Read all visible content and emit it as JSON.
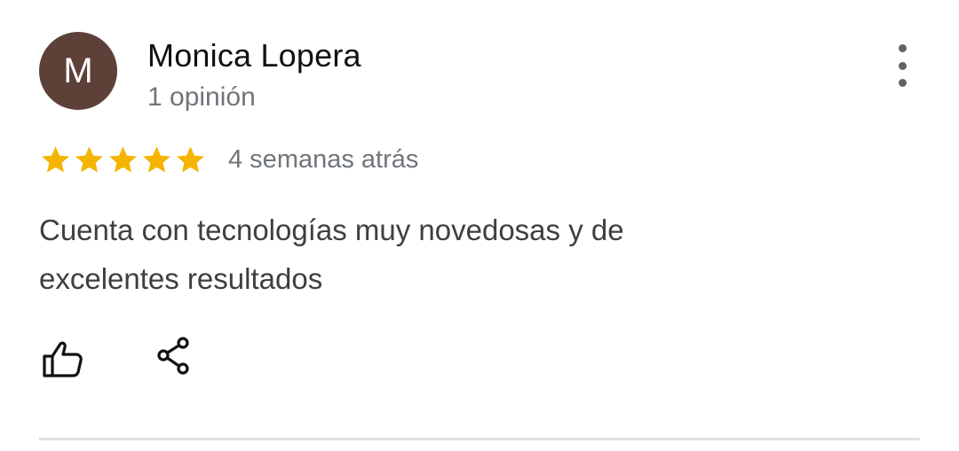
{
  "review": {
    "avatar_letter": "M",
    "avatar_color": "#5d4037",
    "author_name": "Monica Lopera",
    "review_count": "1 opinión",
    "rating": 5,
    "rating_max": 5,
    "star_color": "#f4b400",
    "time": "4 semanas atrás",
    "text": "Cuenta con tecnologías muy novedosas y de excelentes resultados"
  },
  "actions": {
    "more_icon": "more-vert-icon",
    "like_icon": "thumbs-up-icon",
    "share_icon": "share-icon"
  }
}
